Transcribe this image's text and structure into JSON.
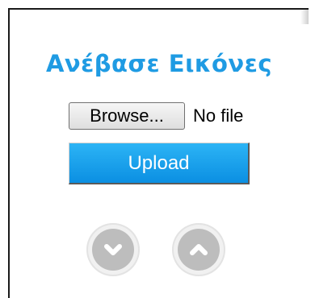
{
  "upload_panel": {
    "title": "Ανέβασε Εικόνες",
    "browse_label": "Browse...",
    "file_status": "No file",
    "upload_label": "Upload",
    "icons": {
      "down": "chevron-down-icon",
      "up": "chevron-up-icon"
    },
    "colors": {
      "title": "#1f9be3",
      "upload_button": "#1aa3ec",
      "nav_circle": "#bdbdbd"
    }
  }
}
